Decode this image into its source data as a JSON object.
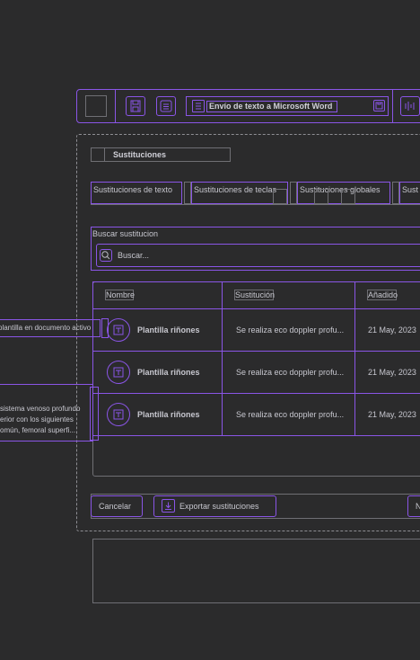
{
  "taskbar": {
    "window_title": "Envío de texto a Microsoft Word"
  },
  "dialog": {
    "title": "Sustituciones",
    "tabs": [
      {
        "label": "Sustituciones de texto"
      },
      {
        "label": "Sustituciones de teclas"
      },
      {
        "label": "Sustituciones globales"
      },
      {
        "label": "Sust"
      }
    ],
    "search": {
      "label": "Buscar sustitucion",
      "placeholder": "Buscar..."
    },
    "table": {
      "columns": [
        "Nombre",
        "Sustitución",
        "Añadido"
      ],
      "rows": [
        {
          "name": "Plantilla riñones",
          "substitution": "Se realiza eco doppler profu...",
          "added": "21 May, 2023"
        },
        {
          "name": "Plantilla riñones",
          "substitution": "Se realiza eco doppler profu...",
          "added": "21 May, 2023"
        },
        {
          "name": "Plantilla riñones",
          "substitution": "Se realiza eco doppler profu...",
          "added": "21 May, 2023"
        }
      ]
    },
    "buttons": {
      "cancel": "Cancelar",
      "export": "Exportar sustituciones",
      "next_partial": "N"
    }
  },
  "tooltips": {
    "insert": "plantilla en documento activo",
    "preview_lines": [
      "sistema venoso profundo",
      "erior con los siguientes",
      "omún, femoral superfi..."
    ]
  }
}
